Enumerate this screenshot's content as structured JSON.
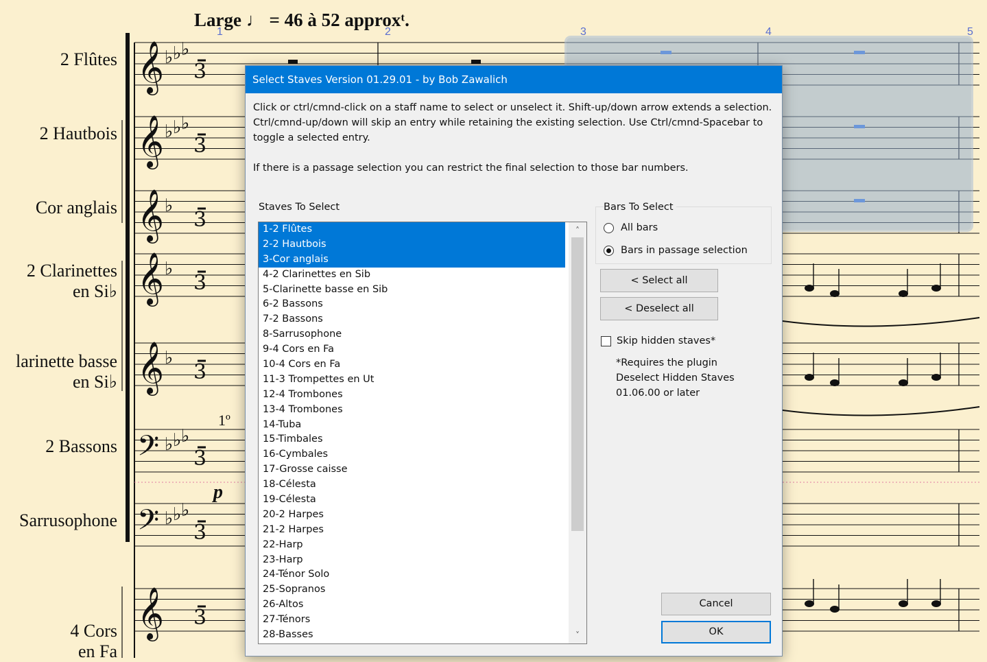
{
  "score": {
    "tempo": "Large ♩ = 46 à 52 approxᵗ.",
    "bar_numbers": [
      "1",
      "2",
      "3",
      "4",
      "5"
    ],
    "staff_names": [
      [
        "2 Flûtes"
      ],
      [
        "2 Hautbois"
      ],
      [
        "Cor anglais"
      ],
      [
        "2 Clarinettes",
        "en Si♭"
      ],
      [
        "larinette basse",
        "en Si♭"
      ],
      [
        "2 Bassons"
      ],
      [
        "Sarrusophone"
      ],
      [
        "4 Cors",
        "en Fa"
      ]
    ],
    "dynamic": "p",
    "primo": "1º"
  },
  "dialog": {
    "title": "Select Staves  Version 01.29.01 - by Bob Zawalich",
    "instructions_1": "Click or ctrl/cmnd-click on a staff name to select or unselect it. Shift-up/down arrow extends a selection. Ctrl/cmnd-up/down will skip an entry while retaining the existing selection. Use Ctrl/cmnd-Spacebar to toggle a selected entry.",
    "instructions_2": "If there is a passage selection you can restrict the final selection to those bar numbers.",
    "staves_label": "Staves To Select",
    "staves": [
      {
        "label": "1-2 Flûtes",
        "selected": true
      },
      {
        "label": "2-2 Hautbois",
        "selected": true
      },
      {
        "label": "3-Cor anglais",
        "selected": true
      },
      {
        "label": "4-2 Clarinettes en Sib",
        "selected": false
      },
      {
        "label": "5-Clarinette basse en Sib",
        "selected": false
      },
      {
        "label": "6-2 Bassons",
        "selected": false
      },
      {
        "label": "7-2 Bassons",
        "selected": false
      },
      {
        "label": "8-Sarrusophone",
        "selected": false
      },
      {
        "label": "9-4 Cors en Fa",
        "selected": false
      },
      {
        "label": "10-4 Cors en Fa",
        "selected": false
      },
      {
        "label": "11-3 Trompettes en Ut",
        "selected": false
      },
      {
        "label": "12-4 Trombones",
        "selected": false
      },
      {
        "label": "13-4 Trombones",
        "selected": false
      },
      {
        "label": "14-Tuba",
        "selected": false
      },
      {
        "label": "15-Timbales",
        "selected": false
      },
      {
        "label": "16-Cymbales",
        "selected": false
      },
      {
        "label": "17-Grosse caisse",
        "selected": false
      },
      {
        "label": "18-Célesta",
        "selected": false
      },
      {
        "label": "19-Célesta",
        "selected": false
      },
      {
        "label": "20-2 Harpes",
        "selected": false
      },
      {
        "label": "21-2 Harpes",
        "selected": false
      },
      {
        "label": "22-Harp",
        "selected": false
      },
      {
        "label": "23-Harp",
        "selected": false
      },
      {
        "label": "24-Ténor Solo",
        "selected": false
      },
      {
        "label": "25-Sopranos",
        "selected": false
      },
      {
        "label": "26-Altos",
        "selected": false
      },
      {
        "label": "27-Ténors",
        "selected": false
      },
      {
        "label": "28-Basses",
        "selected": false
      }
    ],
    "bars_label": "Bars To Select",
    "radio_all": "All bars",
    "radio_passage": "Bars in passage selection",
    "radio_selected": "passage",
    "select_all": "< Select all",
    "deselect_all": "< Deselect all",
    "skip_hidden": "Skip hidden staves*",
    "skip_hidden_checked": false,
    "note_line1": "*Requires the plugin",
    "note_line2": "Deselect Hidden Staves",
    "note_line3": "01.06.00 or later",
    "cancel": "Cancel",
    "ok": "OK",
    "scroll_up": "˄",
    "scroll_down": "˅"
  }
}
